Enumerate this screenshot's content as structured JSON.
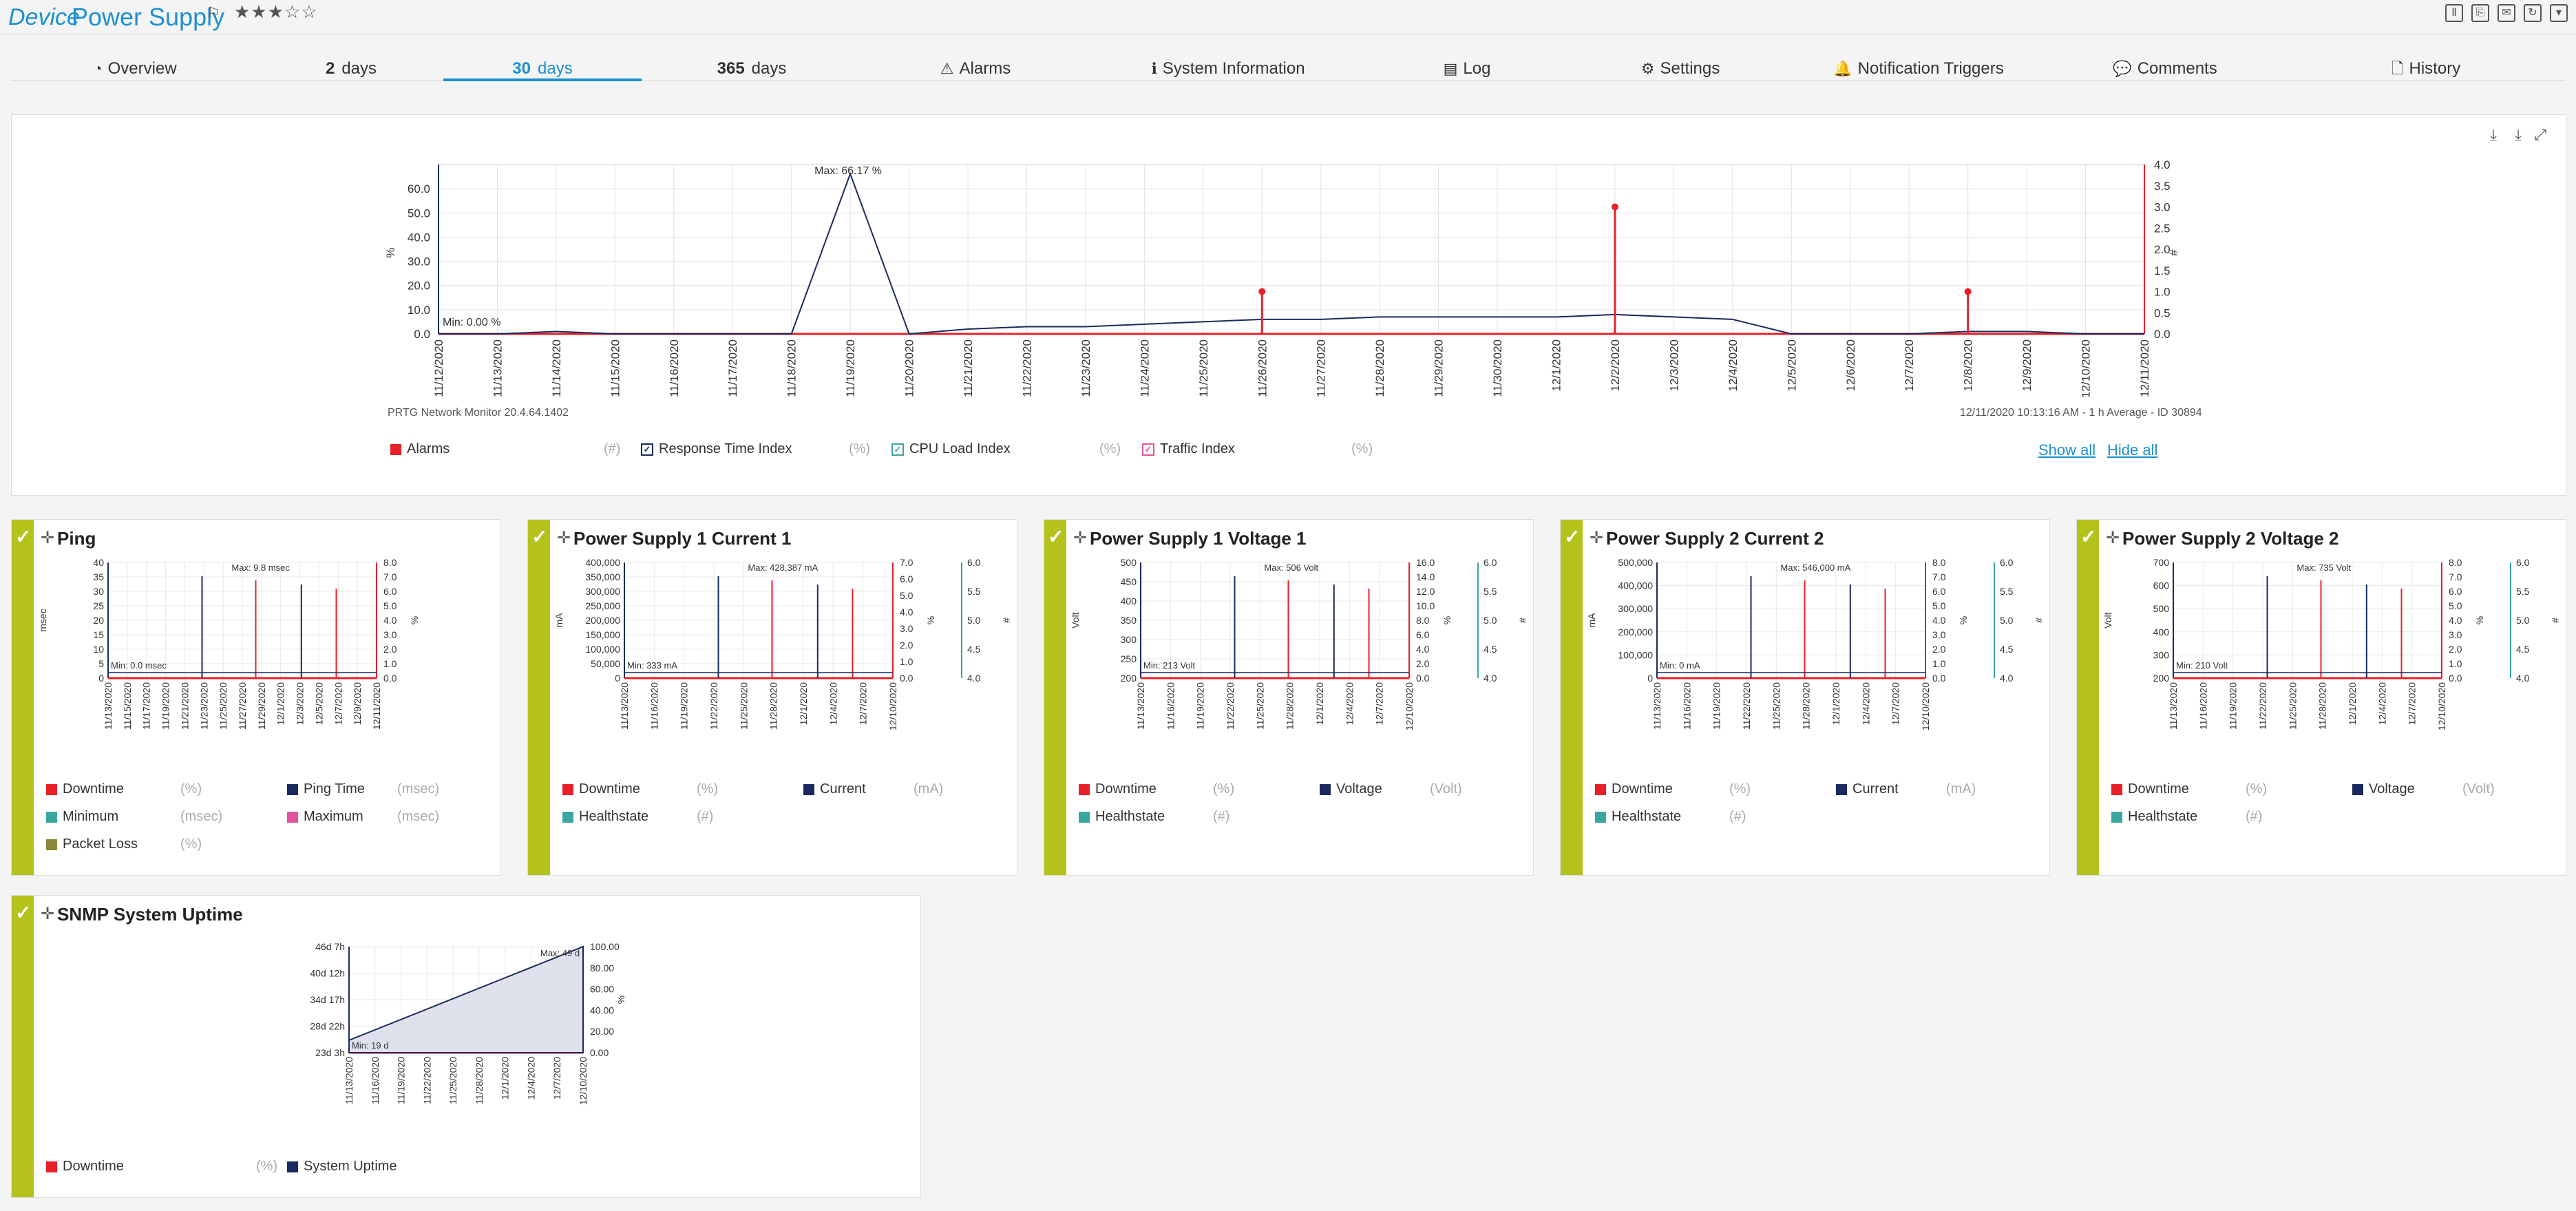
{
  "header": {
    "prefix": "Device",
    "name": "Power Supply",
    "flag": "⚐",
    "stars": "★★★☆☆"
  },
  "header_tools": [
    "pause-icon",
    "export-icon",
    "email-icon",
    "refresh-icon",
    "menu-icon"
  ],
  "tabs": [
    {
      "icon": "◔",
      "num": "",
      "label": "Overview"
    },
    {
      "icon": "",
      "num": "2",
      "label": "days"
    },
    {
      "icon": "",
      "num": "30",
      "label": "days"
    },
    {
      "icon": "",
      "num": "365",
      "label": "days"
    },
    {
      "icon": "⚠",
      "num": "",
      "label": "Alarms"
    },
    {
      "icon": "ℹ",
      "num": "",
      "label": "System Information"
    },
    {
      "icon": "▤",
      "num": "",
      "label": "Log"
    },
    {
      "icon": "⚙",
      "num": "",
      "label": "Settings"
    },
    {
      "icon": "🔔",
      "num": "",
      "label": "Notification Triggers"
    },
    {
      "icon": "💬",
      "num": "",
      "label": "Comments"
    },
    {
      "icon": "🗋",
      "num": "",
      "label": "History"
    }
  ],
  "main_chart": {
    "footer_left": "PRTG Network Monitor 20.4.64.1402",
    "footer_right": "12/11/2020 10:13:16 AM - 1 h Average - ID 30894",
    "max_label": "Max: 66.17 %",
    "min_label": "Min: 0.00 %",
    "ylabel_left": "%",
    "ylabel_right": "#",
    "legend": [
      {
        "label": "Alarms",
        "unit": "(#)",
        "color": "#e8202a",
        "check": false
      },
      {
        "label": "Response Time Index",
        "unit": "(%)",
        "color": "#1a2a5e",
        "check": true
      },
      {
        "label": "CPU Load Index",
        "unit": "(%)",
        "color": "#3aa6a0",
        "check": true
      },
      {
        "label": "Traffic Index",
        "unit": "(%)",
        "color": "#e0559c",
        "check": true
      }
    ],
    "show_all": "Show all",
    "hide_all": "Hide all"
  },
  "chart_data": [
    {
      "type": "line",
      "x": [
        "11/12/2020",
        "11/13/2020",
        "11/14/2020",
        "11/15/2020",
        "11/16/2020",
        "11/17/2020",
        "11/18/2020",
        "11/19/2020",
        "11/20/2020",
        "11/21/2020",
        "11/22/2020",
        "11/23/2020",
        "11/24/2020",
        "11/25/2020",
        "11/26/2020",
        "11/27/2020",
        "11/28/2020",
        "11/29/2020",
        "11/30/2020",
        "12/1/2020",
        "12/2/2020",
        "12/3/2020",
        "12/4/2020",
        "12/5/2020",
        "12/6/2020",
        "12/7/2020",
        "12/8/2020",
        "12/9/2020",
        "12/10/2020",
        "12/11/2020"
      ],
      "ylim_left": [
        0,
        70
      ],
      "yticks_left": [
        "0.0",
        "10.0",
        "20.0",
        "30.0",
        "40.0",
        "50.0",
        "60.0"
      ],
      "ylim_right": [
        0,
        4
      ],
      "yticks_right": [
        "0.0",
        "0.5",
        "1.0",
        "1.5",
        "2.0",
        "2.5",
        "3.0",
        "3.5",
        "4.0"
      ],
      "series": [
        {
          "name": "Response Time Index",
          "color": "#1a2a5e",
          "values": [
            0,
            0,
            1,
            0,
            0,
            0,
            0,
            66.17,
            0,
            2,
            3,
            3,
            4,
            5,
            6,
            6,
            7,
            7,
            7,
            7,
            8,
            7,
            6,
            0,
            0,
            0,
            1,
            1,
            0,
            0
          ]
        },
        {
          "name": "Alarms",
          "color": "#e8202a",
          "values": [
            0,
            0,
            0,
            0,
            0,
            0,
            0,
            0,
            0,
            0,
            0,
            0,
            0,
            0,
            1,
            0,
            0,
            0,
            0,
            0,
            3,
            0,
            0,
            0,
            0,
            0,
            1,
            0,
            0,
            0
          ]
        }
      ]
    }
  ],
  "cards": [
    {
      "title": "Ping",
      "legend": [
        {
          "label": "Downtime",
          "unit": "(%)",
          "color": "#e8202a"
        },
        {
          "label": "Ping Time",
          "unit": "(msec)",
          "color": "#1a2a5e"
        },
        {
          "label": "Minimum",
          "unit": "(msec)",
          "color": "#3aa6a0"
        },
        {
          "label": "Maximum",
          "unit": "(msec)",
          "color": "#e0559c"
        },
        {
          "label": "Packet Loss",
          "unit": "(%)",
          "color": "#8a8a3a"
        }
      ],
      "chart": {
        "ylabel": "msec",
        "left_ticks": [
          "0",
          "5",
          "10",
          "15",
          "20",
          "25",
          "30",
          "35",
          "40"
        ],
        "right_ticks": [
          "0.0",
          "1.0",
          "2.0",
          "3.0",
          "4.0",
          "5.0",
          "6.0",
          "7.0",
          "8.0"
        ],
        "right_label": "%",
        "notes": [
          "Max: 9.8 msec",
          "Min: 0.0 msec"
        ],
        "x": [
          "11/13/2020",
          "11/15/2020",
          "11/17/2020",
          "11/19/2020",
          "11/21/2020",
          "11/23/2020",
          "11/25/2020",
          "11/27/2020",
          "11/29/2020",
          "12/1/2020",
          "12/3/2020",
          "12/5/2020",
          "12/7/2020",
          "12/9/2020",
          "12/11/2020"
        ]
      }
    },
    {
      "title": "Power Supply 1 Current 1",
      "legend": [
        {
          "label": "Downtime",
          "unit": "(%)",
          "color": "#e8202a"
        },
        {
          "label": "Current",
          "unit": "(mA)",
          "color": "#1a2a5e"
        },
        {
          "label": "Healthstate",
          "unit": "(#)",
          "color": "#3aa6a0"
        }
      ],
      "chart": {
        "ylabel": "mA",
        "left_ticks": [
          "0",
          "50,000",
          "100,000",
          "150,000",
          "200,000",
          "250,000",
          "300,000",
          "350,000",
          "400,000"
        ],
        "right_ticks": [
          "0.0",
          "1.0",
          "2.0",
          "3.0",
          "4.0",
          "5.0",
          "6.0",
          "7.0"
        ],
        "right_label": "%",
        "right2_ticks": [
          "4.0",
          "4.5",
          "5.0",
          "5.5",
          "6.0"
        ],
        "right2_label": "#",
        "notes": [
          "Max: 428,387 mA",
          "Min: 333 mA"
        ],
        "x": [
          "11/13/2020",
          "11/16/2020",
          "11/19/2020",
          "11/22/2020",
          "11/25/2020",
          "11/28/2020",
          "12/1/2020",
          "12/4/2020",
          "12/7/2020",
          "12/10/2020"
        ]
      }
    },
    {
      "title": "Power Supply 1 Voltage 1",
      "legend": [
        {
          "label": "Downtime",
          "unit": "(%)",
          "color": "#e8202a"
        },
        {
          "label": "Voltage",
          "unit": "(Volt)",
          "color": "#1a2a5e"
        },
        {
          "label": "Healthstate",
          "unit": "(#)",
          "color": "#3aa6a0"
        }
      ],
      "chart": {
        "ylabel": "Volt",
        "left_ticks": [
          "200",
          "250",
          "300",
          "350",
          "400",
          "450",
          "500"
        ],
        "right_ticks": [
          "0.0",
          "2.0",
          "4.0",
          "6.0",
          "8.0",
          "10.0",
          "12.0",
          "14.0",
          "16.0"
        ],
        "right_label": "%",
        "right2_ticks": [
          "4.0",
          "4.5",
          "5.0",
          "5.5",
          "6.0"
        ],
        "right2_label": "#",
        "notes": [
          "Max: 506 Volt",
          "Min: 213 Volt"
        ],
        "x": [
          "11/13/2020",
          "11/16/2020",
          "11/19/2020",
          "11/22/2020",
          "11/25/2020",
          "11/28/2020",
          "12/1/2020",
          "12/4/2020",
          "12/7/2020",
          "12/10/2020"
        ]
      }
    },
    {
      "title": "Power Supply 2 Current 2",
      "legend": [
        {
          "label": "Downtime",
          "unit": "(%)",
          "color": "#e8202a"
        },
        {
          "label": "Current",
          "unit": "(mA)",
          "color": "#1a2a5e"
        },
        {
          "label": "Healthstate",
          "unit": "(#)",
          "color": "#3aa6a0"
        }
      ],
      "chart": {
        "ylabel": "mA",
        "left_ticks": [
          "0",
          "100,000",
          "200,000",
          "300,000",
          "400,000",
          "500,000"
        ],
        "right_ticks": [
          "0.0",
          "1.0",
          "2.0",
          "3.0",
          "4.0",
          "5.0",
          "6.0",
          "7.0",
          "8.0"
        ],
        "right_label": "%",
        "right2_ticks": [
          "4.0",
          "4.5",
          "5.0",
          "5.5",
          "6.0"
        ],
        "right2_label": "#",
        "notes": [
          "Max: 546,000 mA",
          "Min: 0 mA"
        ],
        "x": [
          "11/13/2020",
          "11/16/2020",
          "11/19/2020",
          "11/22/2020",
          "11/25/2020",
          "11/28/2020",
          "12/1/2020",
          "12/4/2020",
          "12/7/2020",
          "12/10/2020"
        ]
      }
    },
    {
      "title": "Power Supply 2 Voltage 2",
      "legend": [
        {
          "label": "Downtime",
          "unit": "(%)",
          "color": "#e8202a"
        },
        {
          "label": "Voltage",
          "unit": "(Volt)",
          "color": "#1a2a5e"
        },
        {
          "label": "Healthstate",
          "unit": "(#)",
          "color": "#3aa6a0"
        }
      ],
      "chart": {
        "ylabel": "Volt",
        "left_ticks": [
          "200",
          "300",
          "400",
          "500",
          "600",
          "700"
        ],
        "right_ticks": [
          "0.0",
          "1.0",
          "2.0",
          "3.0",
          "4.0",
          "5.0",
          "6.0",
          "7.0",
          "8.0"
        ],
        "right_label": "%",
        "right2_ticks": [
          "4.0",
          "4.5",
          "5.0",
          "5.5",
          "6.0"
        ],
        "right2_label": "#",
        "notes": [
          "Max: 735 Volt",
          "Min: 210 Volt"
        ],
        "x": [
          "11/13/2020",
          "11/16/2020",
          "11/19/2020",
          "11/22/2020",
          "11/25/2020",
          "11/28/2020",
          "12/1/2020",
          "12/4/2020",
          "12/7/2020",
          "12/10/2020"
        ]
      }
    },
    {
      "title": "SNMP System Uptime",
      "legend": [
        {
          "label": "Downtime",
          "unit": "(%)",
          "color": "#e8202a"
        },
        {
          "label": "System Uptime",
          "unit": "",
          "color": "#1a2a5e"
        }
      ],
      "chart": {
        "ylabel": "",
        "left_ticks": [
          "23d 3h",
          "28d 22h",
          "34d 17h",
          "40d 12h",
          "46d 7h"
        ],
        "right_ticks": [
          "0.00",
          "20.00",
          "40.00",
          "60.00",
          "80.00",
          "100.00"
        ],
        "right_label": "%",
        "notes": [
          "Max: 49 d",
          "Min: 19 d"
        ],
        "x": [
          "11/13/2020",
          "11/16/2020",
          "11/19/2020",
          "11/22/2020",
          "11/25/2020",
          "11/28/2020",
          "12/1/2020",
          "12/4/2020",
          "12/7/2020",
          "12/10/2020"
        ]
      }
    }
  ]
}
